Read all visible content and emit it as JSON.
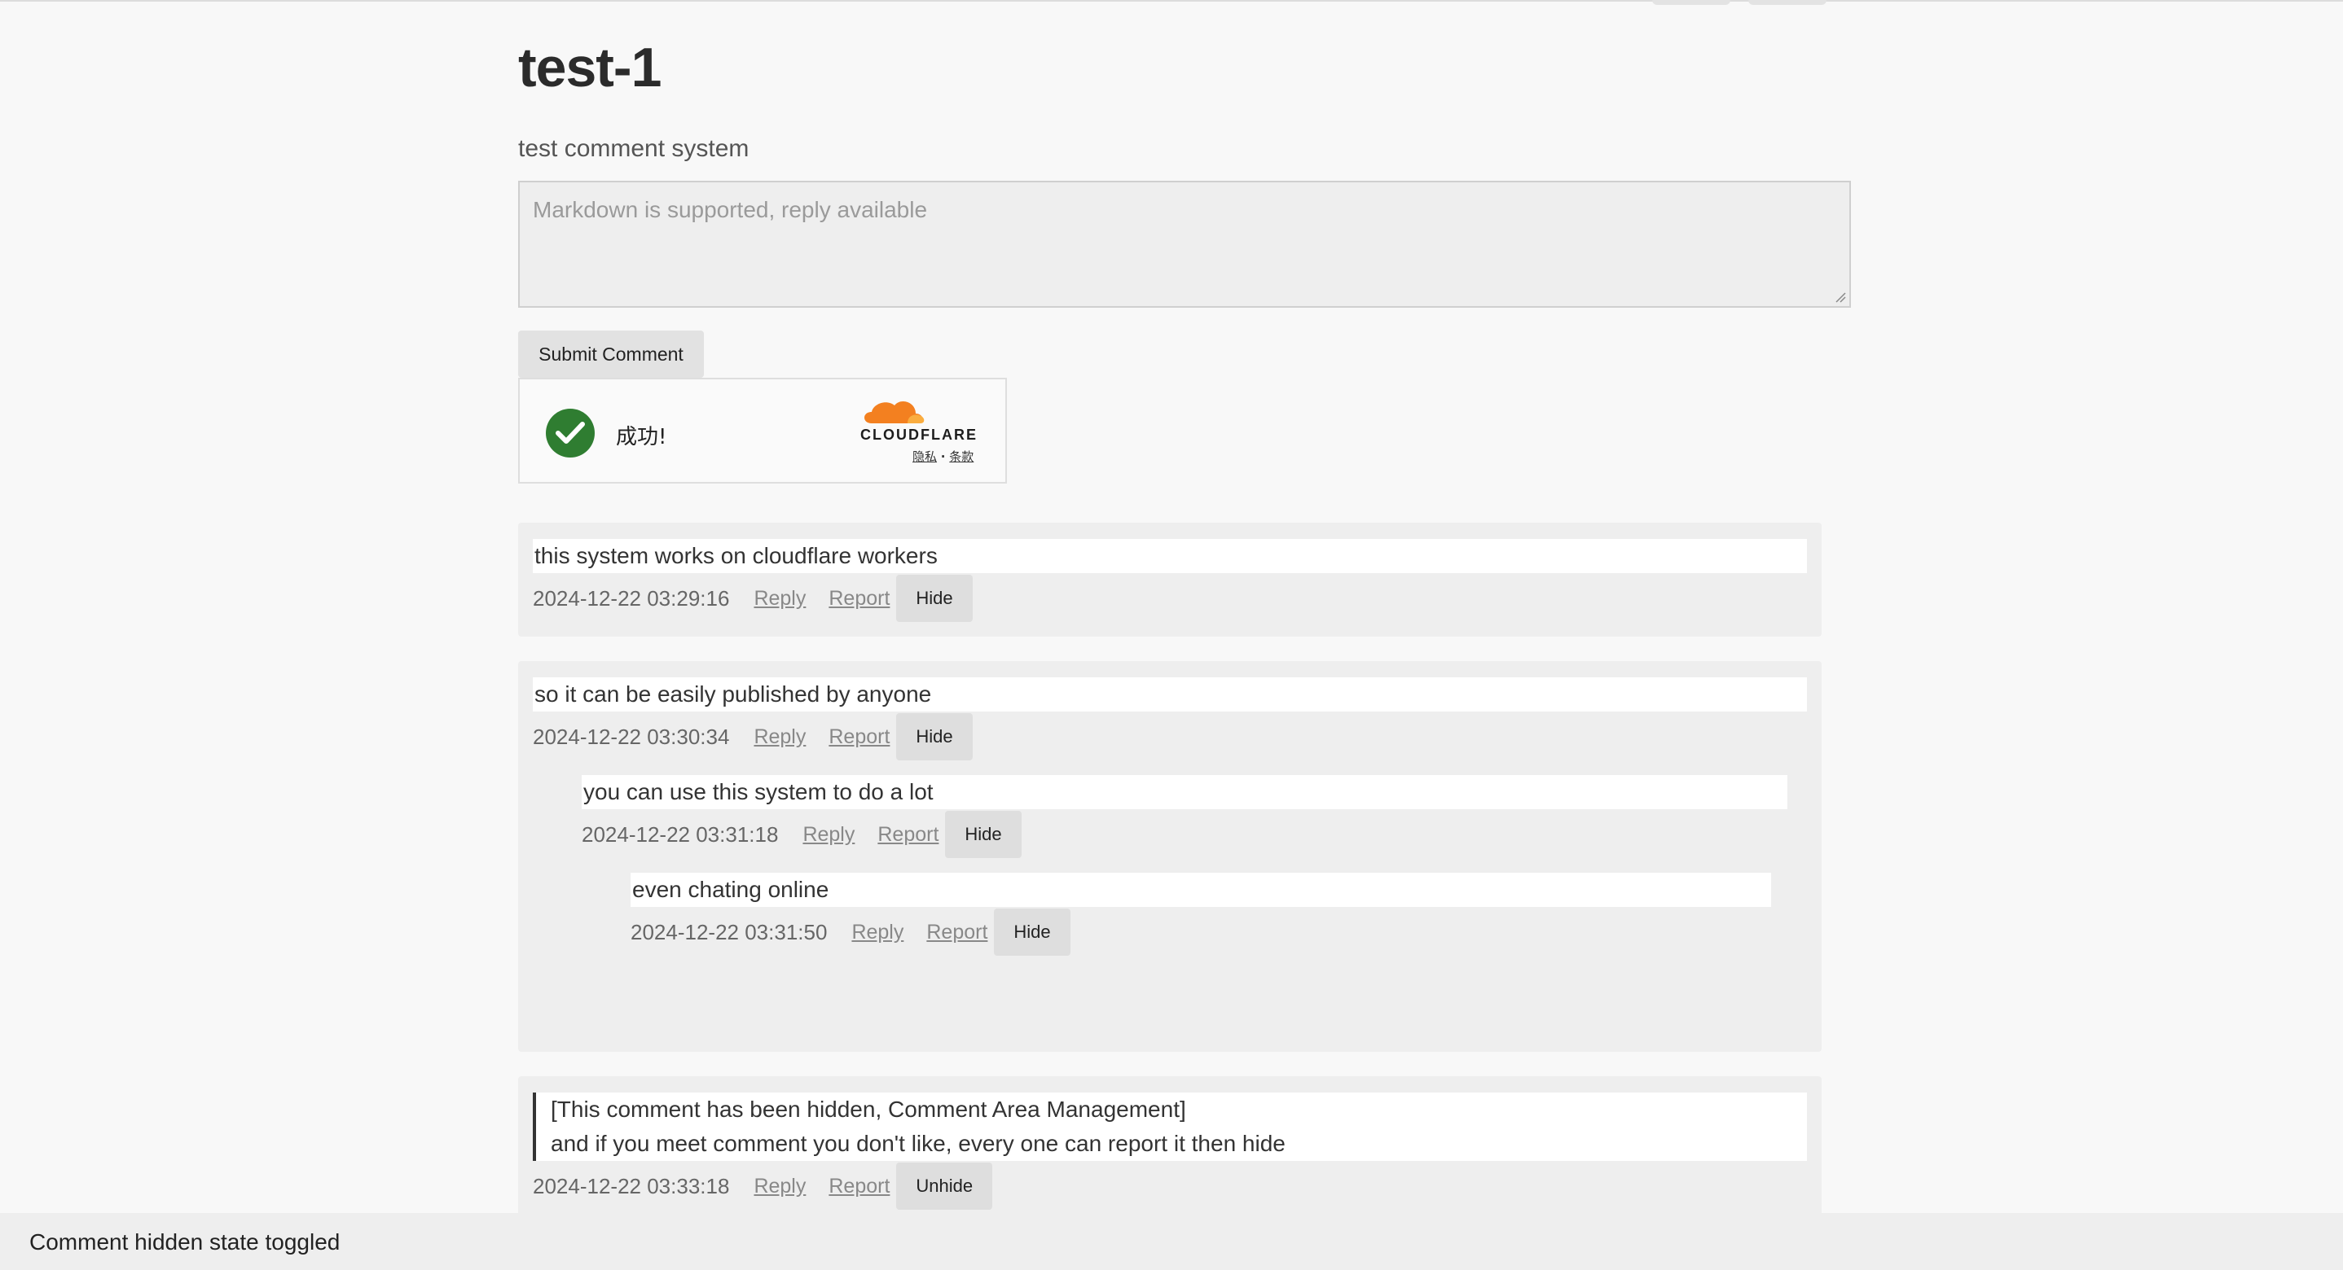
{
  "page": {
    "title": "test-1",
    "subtitle": "test comment system"
  },
  "editor": {
    "placeholder": "Markdown is supported, reply available",
    "value": ""
  },
  "submit": {
    "label": "Submit Comment"
  },
  "captcha": {
    "status": "成功!",
    "brand": "CLOUDFLARE",
    "privacy": "隐私",
    "separator": "·",
    "terms": "条款",
    "check_color": "#2f7d31",
    "brand_color": "#f38020"
  },
  "comments": [
    {
      "text": "this system works on cloudflare workers",
      "time": "2024-12-22 03:29:16",
      "reply": "Reply",
      "report": "Report",
      "toggle": "Hide"
    },
    {
      "text": "so it can be easily published by anyone",
      "time": "2024-12-22 03:30:34",
      "reply": "Reply",
      "report": "Report",
      "toggle": "Hide",
      "replies": [
        {
          "text": "you can use this system to do a lot",
          "time": "2024-12-22 03:31:18",
          "reply": "Reply",
          "report": "Report",
          "toggle": "Hide",
          "replies": [
            {
              "text": "even chating online",
              "time": "2024-12-22 03:31:50",
              "reply": "Reply",
              "report": "Report",
              "toggle": "Hide"
            }
          ]
        }
      ]
    },
    {
      "hidden_notice": "[This comment has been hidden, Comment Area Management]",
      "text": "and if you meet comment you don't like, every one can report it then hide",
      "time": "2024-12-22 03:33:18",
      "reply": "Reply",
      "report": "Report",
      "toggle": "Unhide"
    }
  ],
  "status_bar": {
    "message": "Comment hidden state toggled"
  }
}
